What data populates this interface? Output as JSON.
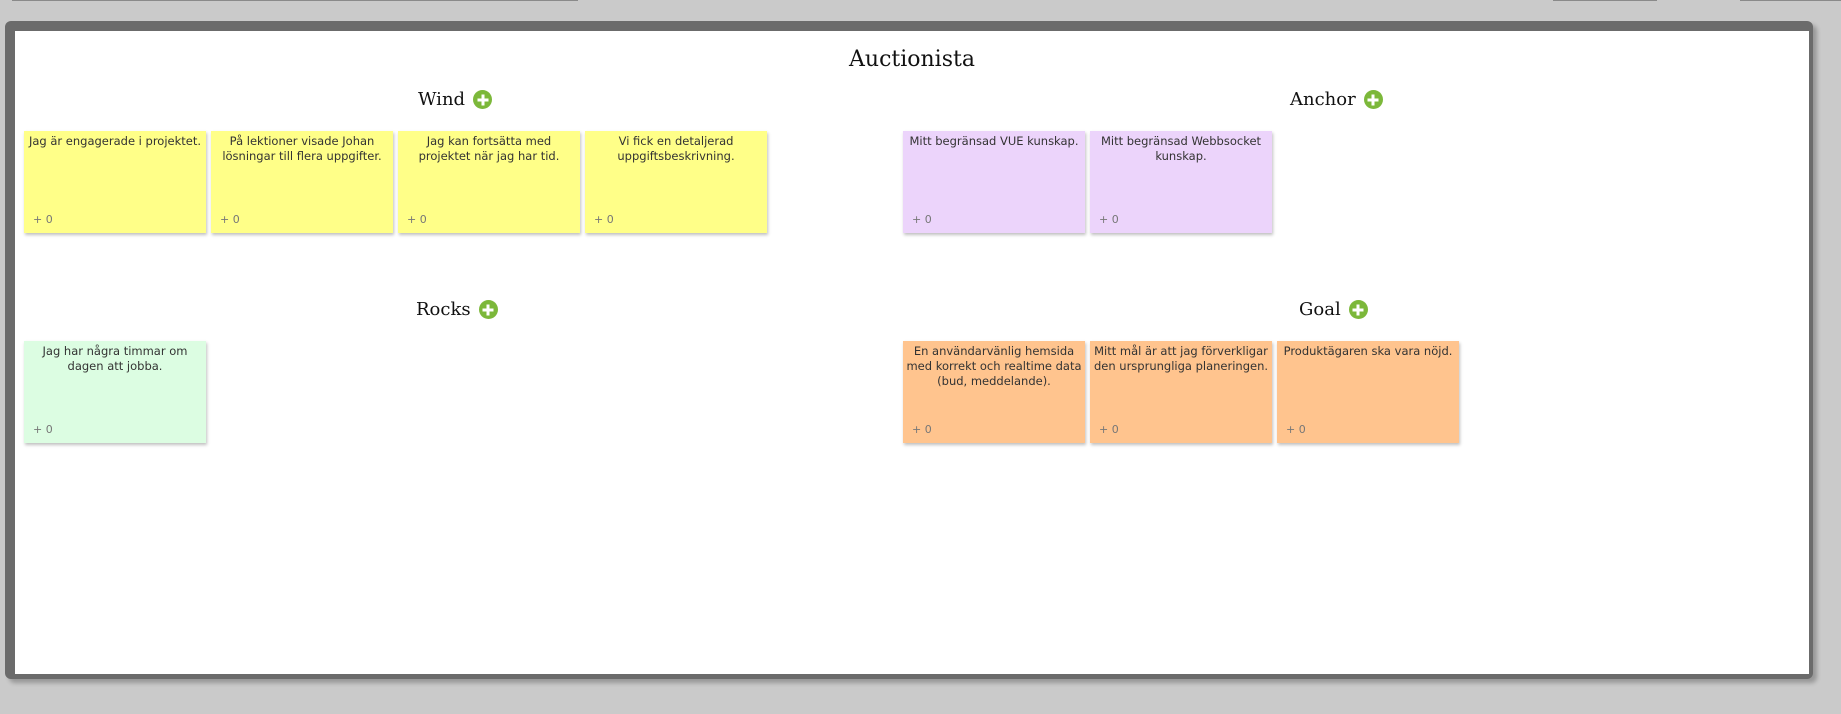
{
  "board": {
    "title": "Auctionista"
  },
  "sections": {
    "wind": {
      "title": "Wind",
      "notes": [
        {
          "text": "Jag är engagerade i projektet.",
          "votes": "+ 0"
        },
        {
          "text": "På lektioner visade Johan lösningar till flera uppgifter.",
          "votes": "+ 0"
        },
        {
          "text": "Jag kan fortsätta med projektet när jag har tid.",
          "votes": "+ 0"
        },
        {
          "text": "Vi fick en detaljerad uppgiftsbeskrivning.",
          "votes": "+ 0"
        }
      ]
    },
    "anchor": {
      "title": "Anchor",
      "notes": [
        {
          "text": "Mitt begränsad VUE kunskap.",
          "votes": "+ 0"
        },
        {
          "text": "Mitt begränsad Webbsocket kunskap.",
          "votes": "+ 0"
        }
      ]
    },
    "rocks": {
      "title": "Rocks",
      "notes": [
        {
          "text": "Jag har några timmar om dagen att jobba.",
          "votes": "+ 0"
        }
      ]
    },
    "goal": {
      "title": "Goal",
      "notes": [
        {
          "text": "En användarvänlig hemsida med korrekt och realtime data (bud, meddelande).",
          "votes": "+ 0"
        },
        {
          "text": "Mitt mål är att jag förverkligar den ursprungliga planeringen.",
          "votes": "+ 0"
        },
        {
          "text": "Produktägaren ska vara nöjd.",
          "votes": "+ 0"
        }
      ]
    }
  },
  "colors": {
    "wind_note": "#ffff88",
    "anchor_note": "#ecd4fb",
    "rocks_note": "#dcfde2",
    "goal_note": "#ffc48e",
    "add_icon": "#7cb83a",
    "frame": "#6b6b6b",
    "page_background": "#cacaca"
  },
  "icons": {
    "add": "plus-circle-icon"
  }
}
